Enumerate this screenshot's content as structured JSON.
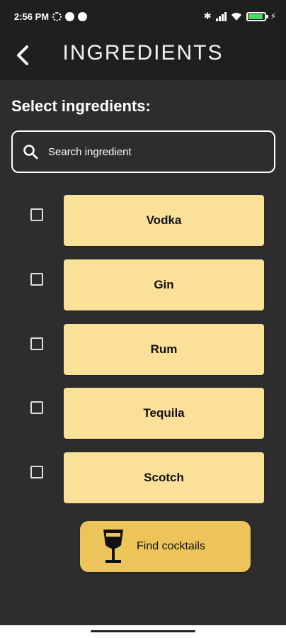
{
  "status_bar": {
    "time": "2:56 PM"
  },
  "header": {
    "title": "INGREDIENTS",
    "back_icon": "chevron-left-icon"
  },
  "section_title": "Select ingredients:",
  "search": {
    "placeholder": "Search ingredient",
    "value": "",
    "icon": "search-icon"
  },
  "ingredients": [
    {
      "label": "Vodka",
      "checked": false
    },
    {
      "label": "Gin",
      "checked": false
    },
    {
      "label": "Rum",
      "checked": false
    },
    {
      "label": "Tequila",
      "checked": false
    },
    {
      "label": "Scotch",
      "checked": false
    }
  ],
  "find_button": {
    "label": "Find cocktails",
    "icon": "wine-glass-icon"
  },
  "colors": {
    "background": "#2d2d2d",
    "header": "#1f1f1f",
    "ingredient_button": "#fbe09a",
    "find_button": "#ecc45a"
  }
}
